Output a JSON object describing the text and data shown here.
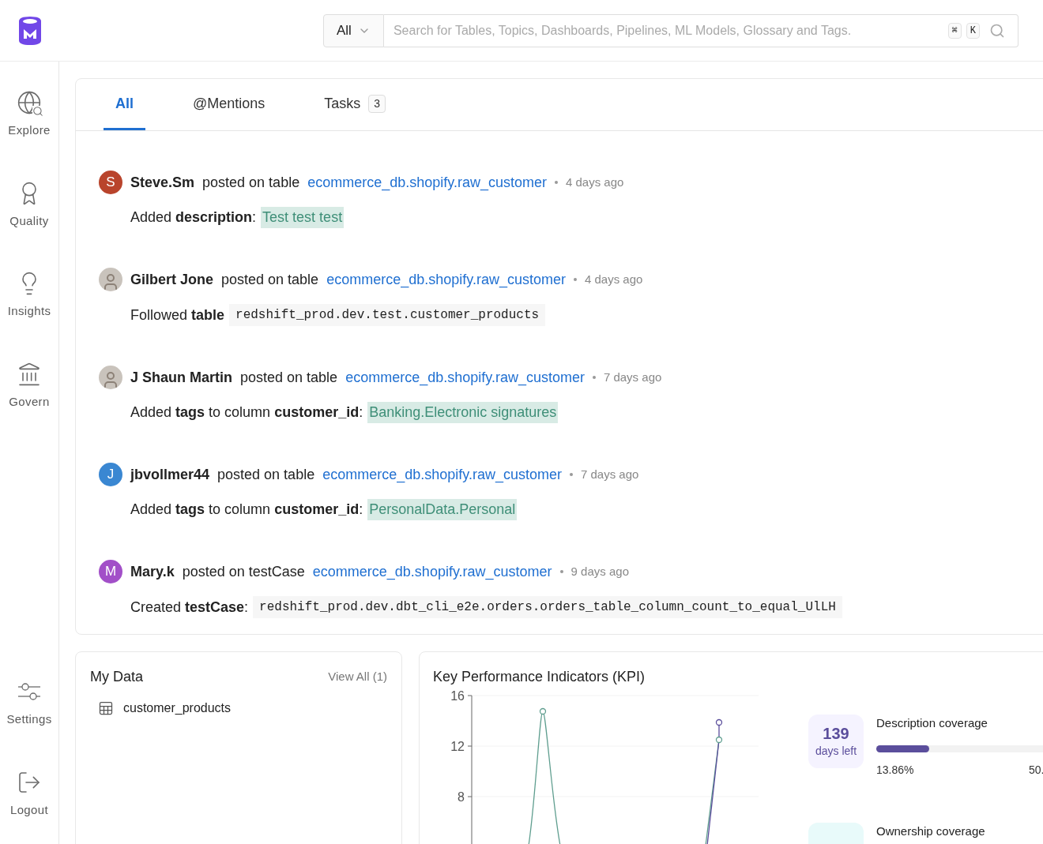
{
  "search": {
    "scope": "All",
    "placeholder": "Search for Tables, Topics, Dashboards, Pipelines, ML Models, Glossary and Tags.",
    "shortcut": [
      "⌘",
      "K"
    ]
  },
  "sidebar": {
    "items": [
      {
        "kind": "explore",
        "label": "Explore"
      },
      {
        "kind": "quality",
        "label": "Quality"
      },
      {
        "kind": "insights",
        "label": "Insights"
      },
      {
        "kind": "govern",
        "label": "Govern"
      }
    ],
    "bottom_items": [
      {
        "kind": "settings",
        "label": "Settings"
      },
      {
        "kind": "logout",
        "label": "Logout"
      }
    ]
  },
  "feed": {
    "tabs": [
      {
        "label": "All",
        "selected": true
      },
      {
        "label": "@Mentions",
        "selected": false
      },
      {
        "label": "Tasks",
        "count": "3",
        "selected": false
      }
    ],
    "items": [
      {
        "avatar": {
          "kind": "letter",
          "letter": "S",
          "color": "#b9442c"
        },
        "author": "Steve.Sm",
        "action": "posted on table",
        "entity": "ecommerce_db.shopify.raw_customer",
        "time": "4 days ago",
        "message": "Added **description**:",
        "value": {
          "kind": "tag",
          "text": "Test test test"
        }
      },
      {
        "avatar": {
          "kind": "photo"
        },
        "author": "Gilbert Jone",
        "action": "posted on table",
        "entity": "ecommerce_db.shopify.raw_customer",
        "time": "4 days ago",
        "message": "Followed **table**",
        "value": {
          "kind": "code",
          "text": "redshift_prod.dev.test.customer_products"
        }
      },
      {
        "avatar": {
          "kind": "photo"
        },
        "author": "J Shaun Martin",
        "action": "posted on table",
        "entity": "ecommerce_db.shopify.raw_customer",
        "time": "7 days ago",
        "message": "Added **tags** to column **customer_id**:",
        "value": {
          "kind": "tag",
          "text": "Banking.Electronic signatures"
        }
      },
      {
        "avatar": {
          "kind": "letter",
          "letter": "J",
          "color": "#3a87d2"
        },
        "author": "jbvollmer44",
        "action": "posted on table",
        "entity": "ecommerce_db.shopify.raw_customer",
        "time": "7 days ago",
        "message": "Added **tags** to column **customer_id**:",
        "value": {
          "kind": "tag",
          "text": "PersonalData.Personal"
        }
      },
      {
        "avatar": {
          "kind": "letter",
          "letter": "M",
          "color": "#a24fc8"
        },
        "author": "Mary.k",
        "action": "posted on testCase",
        "entity": "ecommerce_db.shopify.raw_customer",
        "time": "9 days ago",
        "message": "Created **testCase**:",
        "value": {
          "kind": "code",
          "text": "redshift_prod.dev.dbt_cli_e2e.orders.orders_table_column_count_to_equal_UlLH"
        }
      }
    ]
  },
  "my_data": {
    "title": "My Data",
    "view_all": "View All (1)",
    "items": [
      {
        "name": "customer_products"
      }
    ]
  },
  "kpi": {
    "title": "Key Performance Indicators (KPI)",
    "y_axis_labels": [
      "16",
      "12",
      "8"
    ],
    "metrics": [
      {
        "kind": "description",
        "days": "139",
        "days_label": "days left",
        "label": "Description coverage",
        "level": 0.1386,
        "current": "13.86%",
        "target": "50."
      },
      {
        "kind": "ownership",
        "label": "Ownership coverage"
      }
    ]
  }
}
